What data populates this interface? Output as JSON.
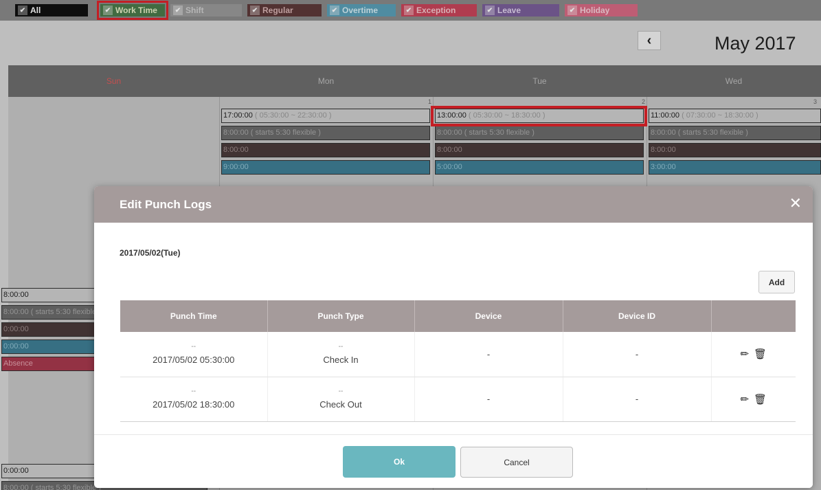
{
  "filters": [
    {
      "key": "all",
      "label": "All"
    },
    {
      "key": "work",
      "label": "Work Time"
    },
    {
      "key": "shift",
      "label": "Shift"
    },
    {
      "key": "regular",
      "label": "Regular"
    },
    {
      "key": "overtime",
      "label": "Overtime"
    },
    {
      "key": "exception",
      "label": "Exception"
    },
    {
      "key": "leave",
      "label": "Leave"
    },
    {
      "key": "holiday",
      "label": "Holiday"
    }
  ],
  "calendar": {
    "month_title": "May 2017",
    "prev_icon": "chevron-left-icon",
    "days": [
      "Sun",
      "Mon",
      "Tue",
      "Wed"
    ],
    "cells": {
      "mon": {
        "day": "1",
        "work": "17:00:00",
        "work_range": "( 05:30:00 ~ 22:30:00 )",
        "shift": "8:00:00 ( starts 5:30 flexible )",
        "regular": "8:00:00",
        "overtime": "9:00:00"
      },
      "tue": {
        "day": "2",
        "work": "13:00:00",
        "work_range": "( 05:30:00 ~ 18:30:00 )",
        "shift": "8:00:00 ( starts 5:30 flexible )",
        "regular": "8:00:00",
        "overtime": "5:00:00"
      },
      "wed": {
        "day": "3",
        "work": "11:00:00",
        "work_range": "( 07:30:00 ~ 18:30:00 )",
        "shift": "8:00:00 ( starts 5:30 flexible )",
        "regular": "8:00:00",
        "overtime": "3:00:00"
      },
      "sun_week2": {
        "work": "8:00:00",
        "shift": "8:00:00 ( starts 5:30 flexible )",
        "regular": "0:00:00",
        "overtime": "0:00:00",
        "absence": "Absence"
      },
      "sun_week3": {
        "work": "0:00:00",
        "shift": "8:00:00 ( starts 5:30 flexible )"
      }
    }
  },
  "modal": {
    "title": "Edit Punch Logs",
    "close_icon": "close-icon",
    "date": "2017/05/02(Tue)",
    "add_label": "Add",
    "columns": [
      "Punch Time",
      "Punch Type",
      "Device",
      "Device ID",
      ""
    ],
    "rows": [
      {
        "dash": "--",
        "time": "2017/05/02 05:30:00",
        "type": "Check In",
        "device": "-",
        "device_id": "-"
      },
      {
        "dash": "--",
        "time": "2017/05/02 18:30:00",
        "type": "Check Out",
        "device": "-",
        "device_id": "-"
      }
    ],
    "ok_label": "Ok",
    "cancel_label": "Cancel"
  }
}
